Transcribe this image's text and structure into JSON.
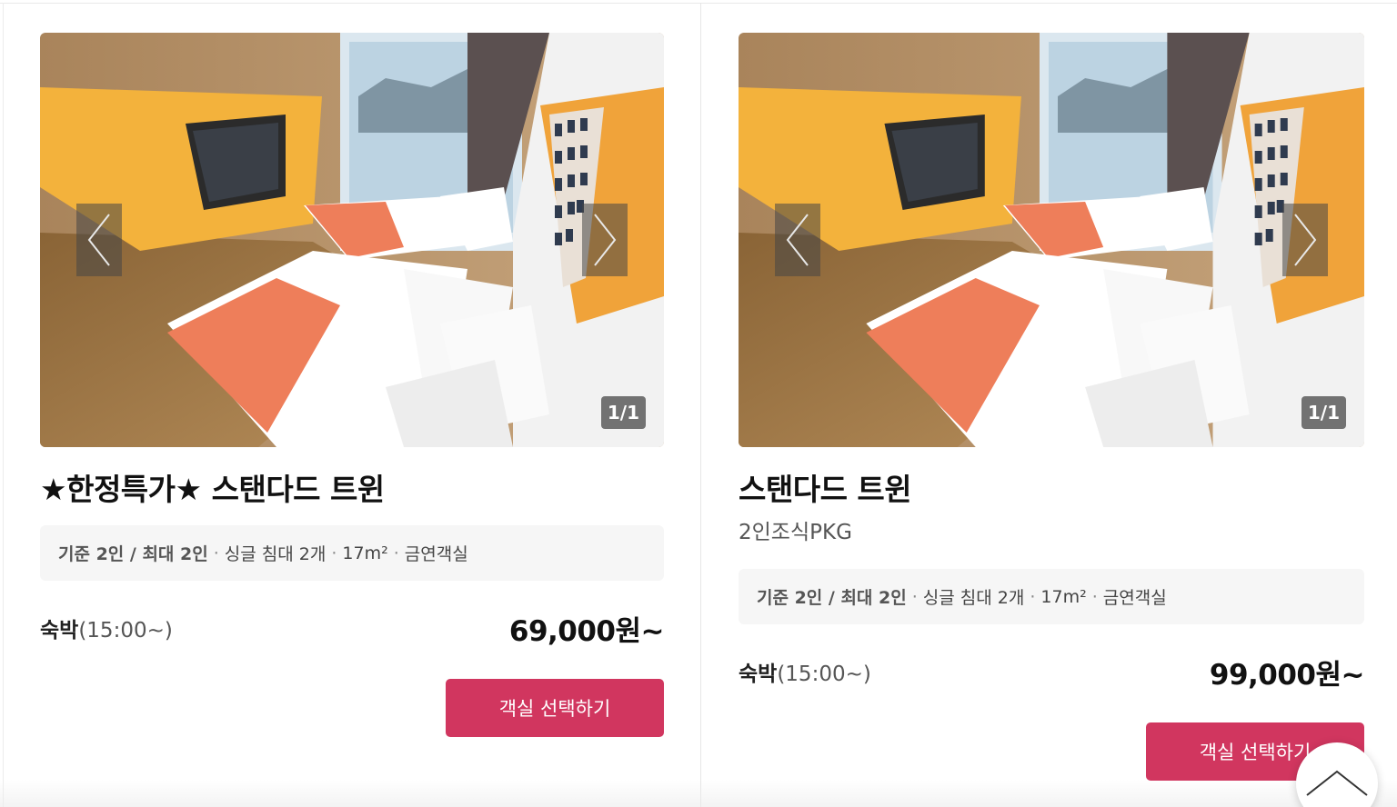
{
  "rooms": [
    {
      "title": "★한정특가★ 스탠다드 트윈",
      "subtitle": "",
      "counter": "1/1",
      "spec": {
        "capacity": "기준 2인 / 최대 2인",
        "items": [
          "싱글 침대 2개",
          "17m²",
          "금연객실"
        ],
        "separator": "·"
      },
      "stay_label": "숙박",
      "stay_time": "(15:00~)",
      "price": "69,000원~",
      "button_label": "객실 선택하기"
    },
    {
      "title": "스탠다드 트윈",
      "subtitle": "2인조식PKG",
      "counter": "1/1",
      "spec": {
        "capacity": "기준 2인 / 최대 2인",
        "items": [
          "싱글 침대 2개",
          "17m²",
          "금연객실"
        ],
        "separator": "·"
      },
      "stay_label": "숙박",
      "stay_time": "(15:00~)",
      "price": "99,000원~",
      "button_label": "객실 선택하기"
    }
  ],
  "icons": {
    "prev": "chevron-left-icon",
    "next": "chevron-right-icon",
    "scroll_top": "chevron-up-icon"
  },
  "colors": {
    "accent": "#d1365f",
    "spec_bg": "#f6f6f6"
  }
}
